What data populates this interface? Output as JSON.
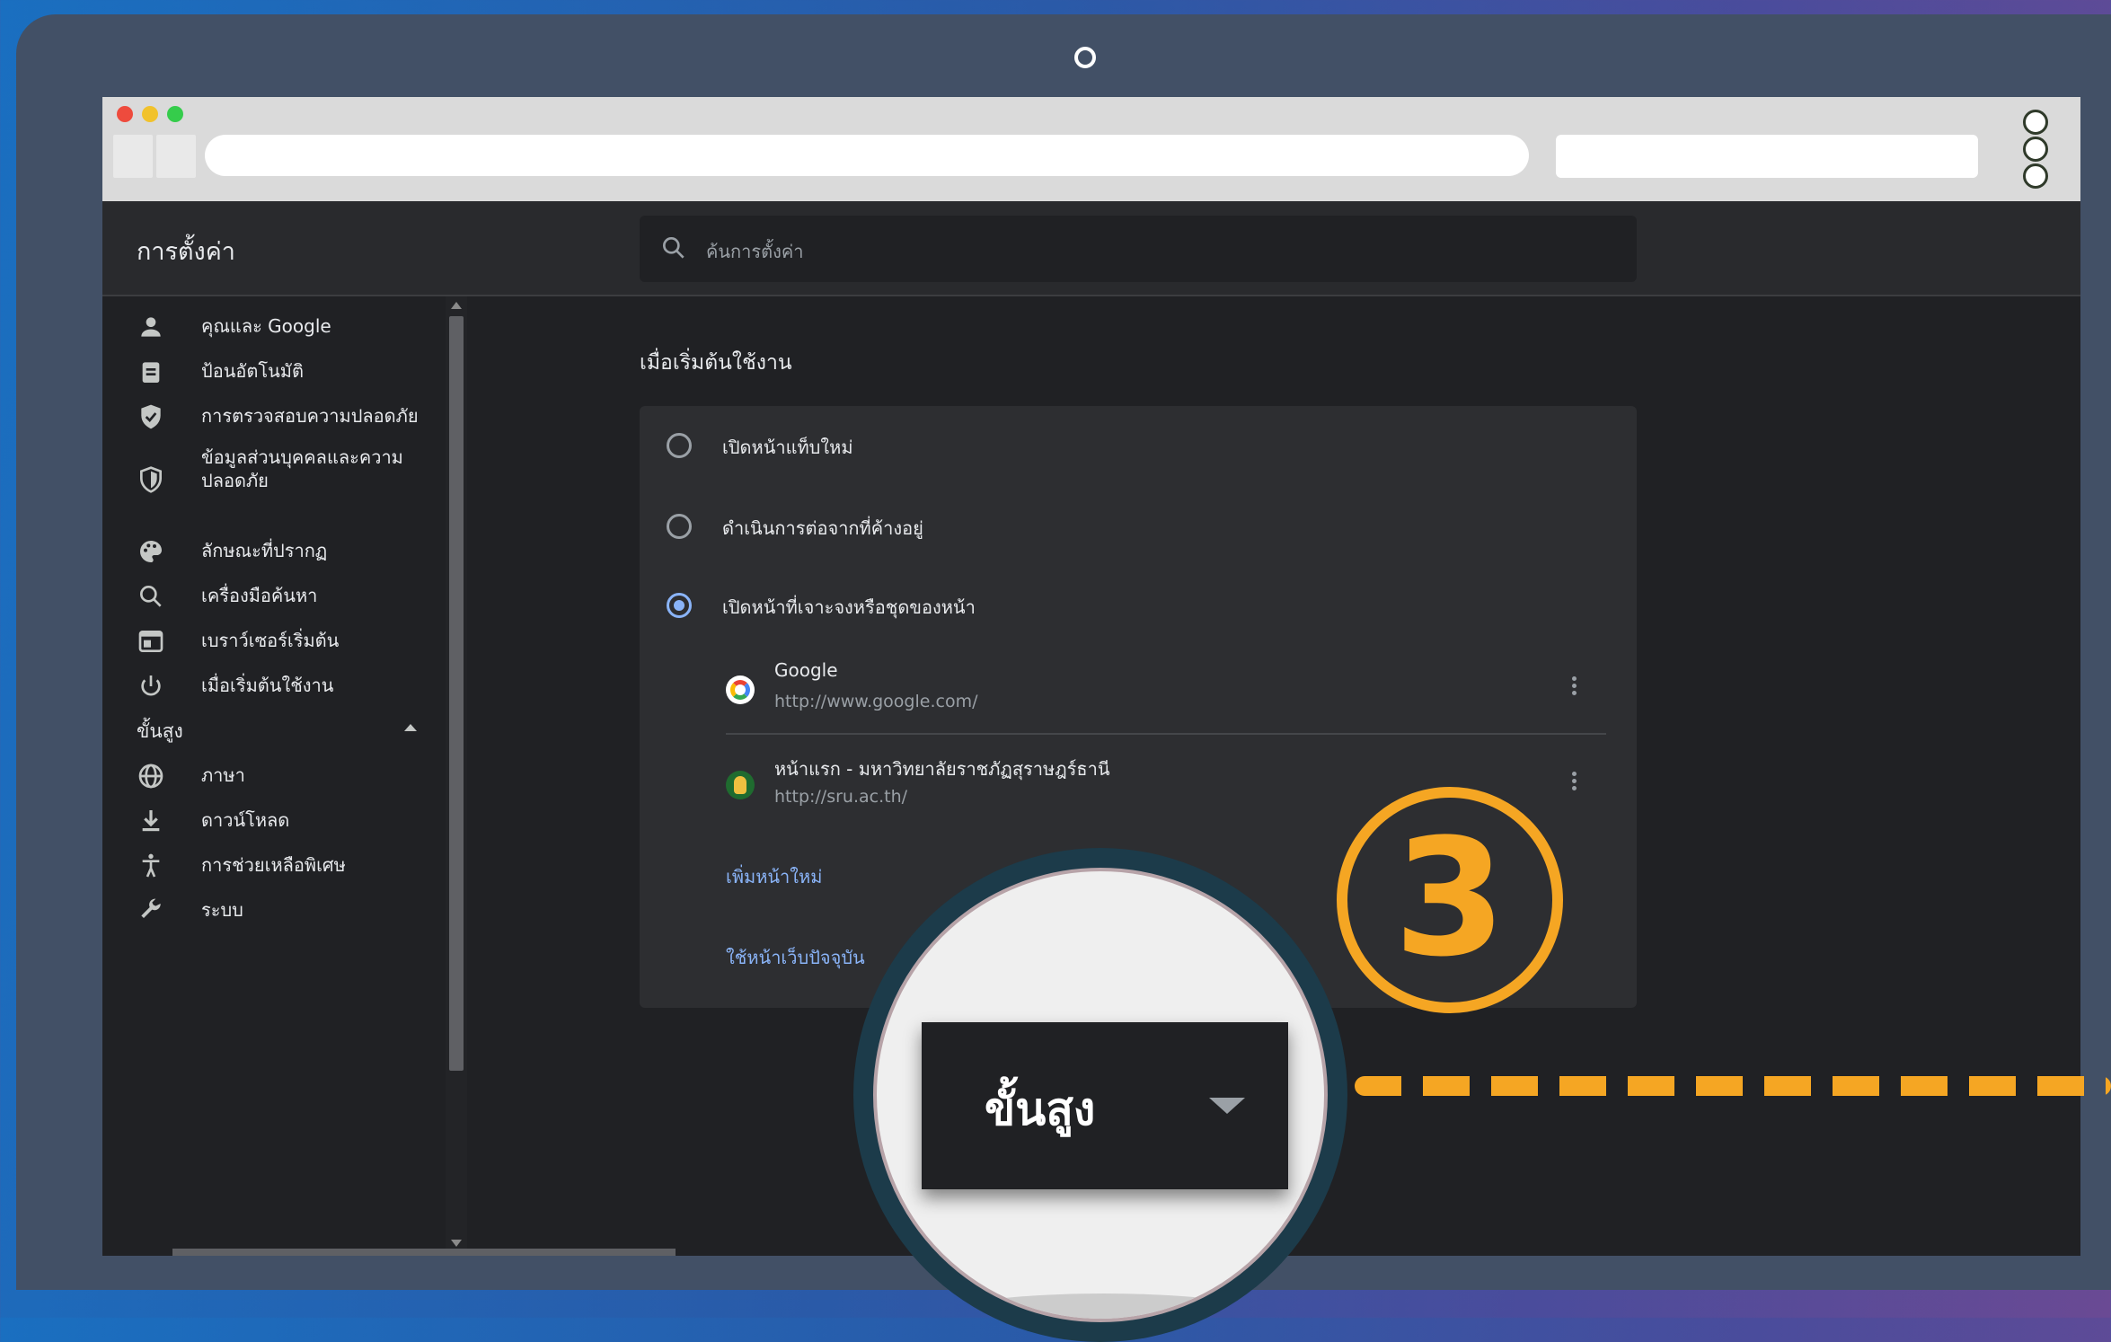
{
  "header": {
    "title": "การตั้งค่า",
    "search_placeholder": "ค้นการตั้งค่า"
  },
  "sidebar": {
    "items": [
      {
        "label": "คุณและ Google",
        "icon": "person-icon"
      },
      {
        "label": "ป้อนอัตโนมัติ",
        "icon": "clipboard-icon"
      },
      {
        "label": "การตรวจสอบความปลอดภัย",
        "icon": "shield-check-icon"
      },
      {
        "label": "ข้อมูลส่วนบุคคลและความปลอดภัย",
        "icon": "shield-icon"
      },
      {
        "label": "ลักษณะที่ปรากฏ",
        "icon": "palette-icon"
      },
      {
        "label": "เครื่องมือค้นหา",
        "icon": "search-icon"
      },
      {
        "label": "เบราว์เซอร์เริ่มต้น",
        "icon": "browser-icon"
      },
      {
        "label": "เมื่อเริ่มต้นใช้งาน",
        "icon": "power-icon"
      }
    ],
    "advanced_label": "ขั้นสูง",
    "advanced_items": [
      {
        "label": "ภาษา",
        "icon": "globe-icon"
      },
      {
        "label": "ดาวน์โหลด",
        "icon": "download-icon"
      },
      {
        "label": "การช่วยเหลือพิเศษ",
        "icon": "accessibility-icon"
      },
      {
        "label": "ระบบ",
        "icon": "wrench-icon"
      }
    ]
  },
  "main": {
    "section_title": "เมื่อเริ่มต้นใช้งาน",
    "options": [
      {
        "label": "เปิดหน้าแท็บใหม่",
        "checked": false
      },
      {
        "label": "ดำเนินการต่อจากที่ค้างอยู่",
        "checked": false
      },
      {
        "label": "เปิดหน้าที่เจาะจงหรือชุดของหน้า",
        "checked": true
      }
    ],
    "pages": [
      {
        "name": "Google",
        "url": "http://www.google.com/"
      },
      {
        "name": "หน้าแรก - มหาวิทยาลัยราชภัฏสุราษฎร์ธานี",
        "url": "http://sru.ac.th/"
      }
    ],
    "add_page": "เพิ่มหน้าใหม่",
    "use_current": "ใช้หน้าเว็บปัจจุบัน"
  },
  "overlay": {
    "step_number": "3",
    "magnified_label": "ขั้นสูง"
  },
  "colors": {
    "accent": "#8ab4f8",
    "badge": "#f5a623"
  }
}
